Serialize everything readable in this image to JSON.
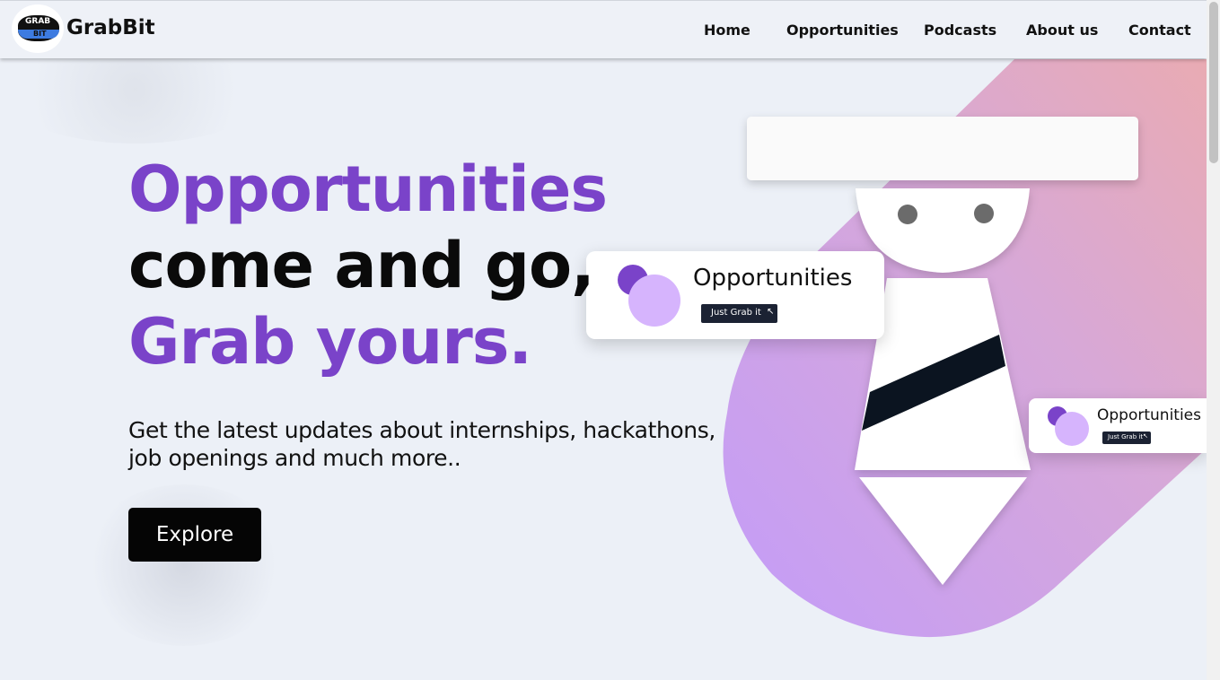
{
  "header": {
    "logo_line1": "GRAB",
    "logo_line2": "BIT",
    "brand": "GrabBit",
    "nav": [
      "Home",
      "Opportunities",
      "Podcasts",
      "About us",
      "Contact"
    ]
  },
  "hero": {
    "line1": "Opportunities",
    "line2": "come and go,",
    "line3": "Grab yours.",
    "subtitle_line1": "Get the latest updates about internships, hackathons,",
    "subtitle_line2": "job openings and much more..",
    "cta": "Explore"
  },
  "illustration": {
    "card_large_title": "Opportunities",
    "card_large_button": "Just Grab it",
    "card_small_title": "Opportunities",
    "card_small_button": "Just Grab it"
  },
  "colors": {
    "accent": "#7a43c9",
    "background": "#ecf0f7",
    "button": "#050505"
  }
}
